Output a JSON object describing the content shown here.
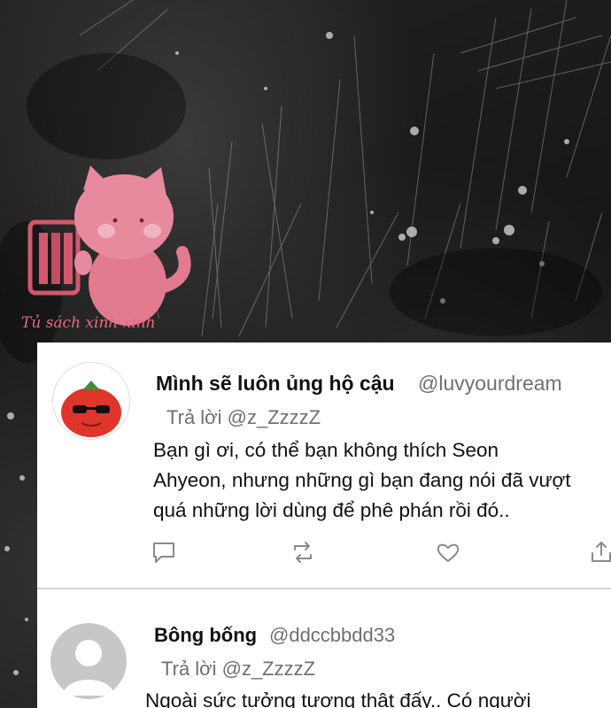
{
  "watermark": {
    "text": "Tủ sách xinh xinh",
    "color": "#e86a86"
  },
  "comments": [
    {
      "display_name": "Mình sẽ luôn ủng hộ cậu",
      "handle": "@luvyourdream",
      "reply_to": "Trả lời @z_ZzzzZ",
      "body_lines": [
        "Bạn gì ơi, có thể bạn không thích Seon",
        "Ahyeon, nhưng những gì bạn đang nói đã vượt",
        "quá những lời dùng để phê phán rồi đó.."
      ],
      "avatar_icon": "tomato-with-sunglasses-avatar",
      "actions": [
        "reply-icon",
        "retweet-icon",
        "like-icon",
        "share-icon"
      ]
    },
    {
      "display_name": "Bông bống",
      "handle": "@ddccbbdd33",
      "reply_to": "Trả lời @z_ZzzzZ",
      "body_lines": [
        "Ngoài sức tưởng tượng thật đấy.. Có người"
      ],
      "avatar_icon": "default-user-avatar"
    }
  ],
  "colors": {
    "card_bg": "#ffffff",
    "text": "#111111",
    "muted": "#707070",
    "divider": "#d4d4d4",
    "icon": "#8a8a8a"
  }
}
